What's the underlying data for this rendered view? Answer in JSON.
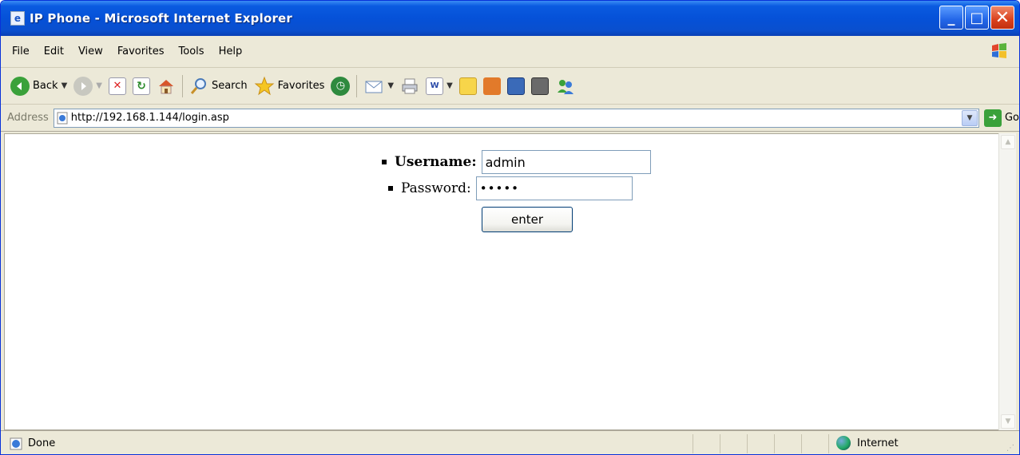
{
  "window": {
    "title": "IP Phone - Microsoft Internet Explorer",
    "minimize_glyph": "_",
    "maximize_glyph": "□",
    "close_glyph": "✕"
  },
  "menu": {
    "items": [
      "File",
      "Edit",
      "View",
      "Favorites",
      "Tools",
      "Help"
    ]
  },
  "toolbar": {
    "back_label": "Back",
    "search_label": "Search",
    "favorites_label": "Favorites"
  },
  "address": {
    "label": "Address",
    "url": "http://192.168.1.144/login.asp",
    "go_label": "Go"
  },
  "form": {
    "username_label": "Username:",
    "username_value": "admin",
    "password_label": "Password:",
    "password_value": "•••••",
    "submit_label": "enter"
  },
  "status": {
    "text": "Done",
    "zone": "Internet"
  },
  "colors": {
    "titlebar": "#0551d8",
    "chrome": "#ece9d8",
    "input_border": "#7f9db9"
  }
}
